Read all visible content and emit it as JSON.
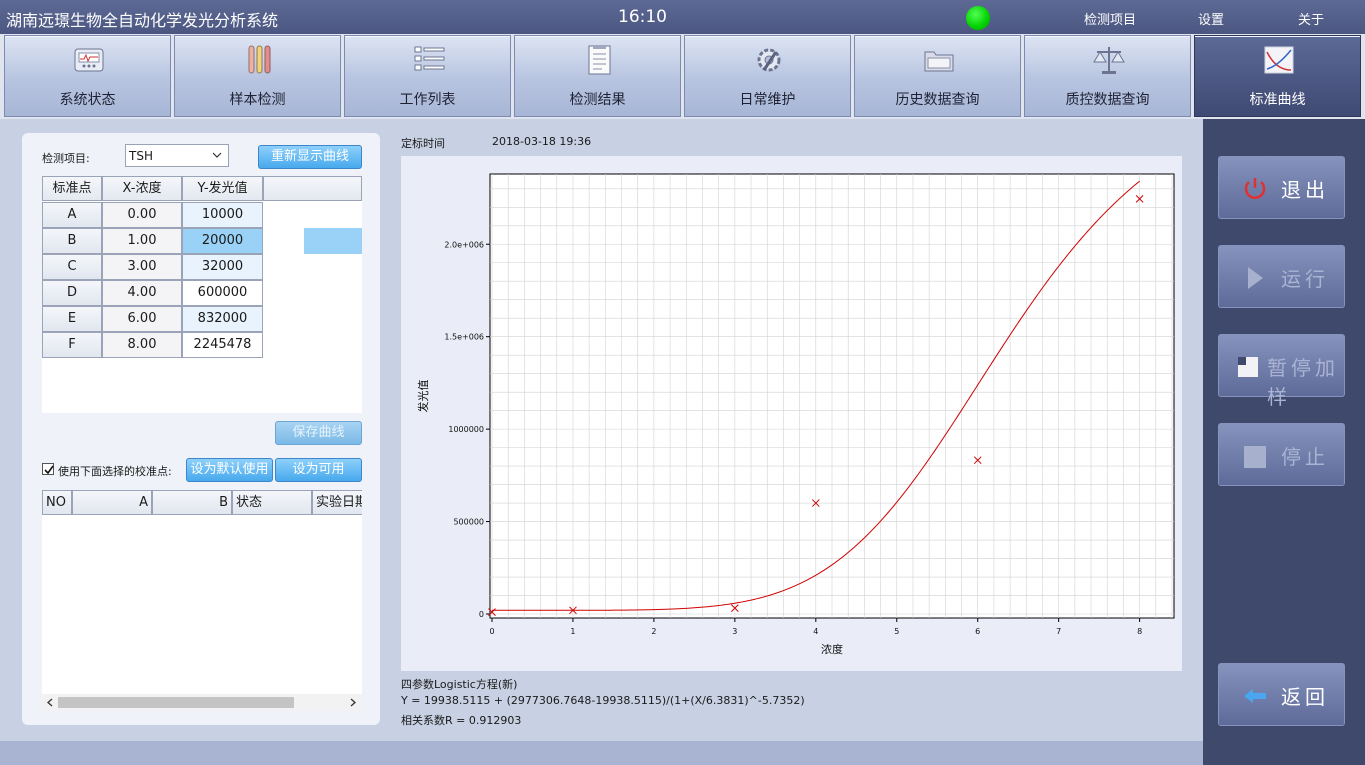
{
  "titlebar": {
    "title": "湖南远璟生物全自动化学发光分析系统",
    "clock": "16:10",
    "status_color": "#00d000",
    "menu": [
      "检测项目",
      "设置",
      "关于"
    ]
  },
  "nav": [
    {
      "label": "系统状态",
      "icon": "monitor-icon"
    },
    {
      "label": "样本检测",
      "icon": "test-tubes-icon"
    },
    {
      "label": "工作列表",
      "icon": "list-icon"
    },
    {
      "label": "检测结果",
      "icon": "document-icon"
    },
    {
      "label": "日常维护",
      "icon": "gear-wrench-icon"
    },
    {
      "label": "历史数据查询",
      "icon": "folder-icon"
    },
    {
      "label": "质控数据查询",
      "icon": "scale-icon"
    },
    {
      "label": "标准曲线",
      "icon": "curve-icon",
      "active": true
    }
  ],
  "left": {
    "item_label": "检测项目:",
    "item_value": "TSH",
    "redisplay_button": "重新显示曲线",
    "table_headers": [
      "标准点",
      "X-浓度",
      "Y-发光值"
    ],
    "rows": [
      {
        "point": "A",
        "x": "0.00",
        "y": "10000"
      },
      {
        "point": "B",
        "x": "1.00",
        "y": "20000"
      },
      {
        "point": "C",
        "x": "3.00",
        "y": "32000"
      },
      {
        "point": "D",
        "x": "4.00",
        "y": "600000"
      },
      {
        "point": "E",
        "x": "6.00",
        "y": "832000"
      },
      {
        "point": "F",
        "x": "8.00",
        "y": "2245478"
      }
    ],
    "save_button": "保存曲线",
    "checkbox_checked": true,
    "checkbox_label": "使用下面选择的校准点:",
    "set_default_button": "设为默认使用",
    "set_available_button": "设为可用",
    "lower_headers": [
      "NO",
      "A",
      "B",
      "状态",
      "实验日期"
    ]
  },
  "chart_header": {
    "label": "定标时间",
    "value": "2018-03-18 19:36"
  },
  "chart_data": {
    "type": "scatter",
    "xlabel": "浓度",
    "ylabel": "发光值",
    "xlim": [
      0,
      8.4
    ],
    "ylim": [
      0,
      2380000
    ],
    "x_ticks": [
      "0",
      "1",
      "2",
      "3",
      "4",
      "5",
      "6",
      "7",
      "8"
    ],
    "y_ticks": [
      {
        "v": 0,
        "label": "0"
      },
      {
        "v": 500000,
        "label": "500000"
      },
      {
        "v": 1000000,
        "label": "1000000"
      },
      {
        "v": 1500000,
        "label": "1.5e+006"
      },
      {
        "v": 2000000,
        "label": "2.0e+006"
      }
    ],
    "points": [
      {
        "x": 0,
        "y": 10000
      },
      {
        "x": 1,
        "y": 20000
      },
      {
        "x": 3,
        "y": 32000
      },
      {
        "x": 4,
        "y": 600000
      },
      {
        "x": 6,
        "y": 832000
      },
      {
        "x": 8,
        "y": 2245478
      }
    ],
    "fit": {
      "model": "logistic4",
      "A": 19938.5115,
      "D": 2977306.7648,
      "C": 6.3831,
      "B": -5.7352
    },
    "grid": true,
    "curve_color": "#d00000",
    "marker_color": "#d00000"
  },
  "formula": {
    "line1": "四参数Logistic方程(新)",
    "line2": "Y = 19938.5115 + (2977306.7648-19938.5115)/(1+(X/6.3831)^-5.7352)",
    "line3": "相关系数R = 0.912903"
  },
  "sidebar": {
    "exit": "退出",
    "run": "运行",
    "pause": "暂停加样",
    "stop": "停止",
    "back": "返回"
  }
}
